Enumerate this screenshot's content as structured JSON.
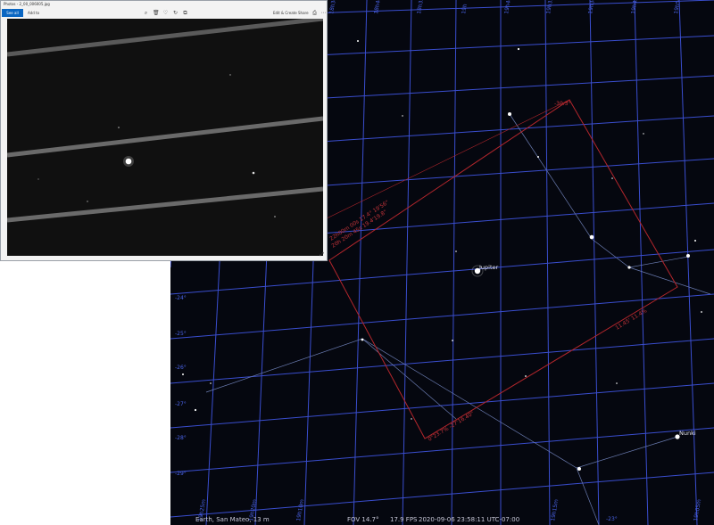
{
  "photos": {
    "title": "Photos - 2_00_006005.jpg",
    "see_all": "See all photos",
    "add_to": "Add to",
    "edit_create": "Edit & Create",
    "share": "Share",
    "icons": [
      "zoom-icon",
      "delete-icon",
      "favorite-icon",
      "rotate-icon",
      "crop-icon",
      "edit-icon",
      "share-icon",
      "print-icon",
      "more-icon",
      "expand-icon"
    ]
  },
  "sky": {
    "ra_labels": [
      "18h30m",
      "18h40m",
      "18h35m",
      "19h",
      "19h40m",
      "19h35m",
      "19h30m",
      "19h45m",
      "19h50m",
      "19h25m",
      "19h20m",
      "19h10m",
      "19h15m",
      "19h05m"
    ],
    "dec_labels": [
      "-23°",
      "-24°",
      "-25°",
      "-26°",
      "-27°",
      "-28°",
      "-29°"
    ],
    "jupiter": "Jupiter",
    "nunki": "Nunki",
    "box_labels": [
      "-30.3°",
      "22h00m 00s 17.4° 19'56\"",
      "20h 20m 45s 19.4'19.8\"",
      "11.45' 11.4%",
      "0\"23.7% -27'16.40\""
    ],
    "status_location": "Earth, San Mateo, 13 m",
    "status_fov": "FOV 14.7°",
    "status_fps": "17.9 FPS",
    "status_time": "2020-09-06 23:58:11 UTC-07:00"
  },
  "colors": {
    "grid": "#3a4ecf",
    "box": "#b3262c",
    "sky_bg": "#05070f",
    "accent": "#0a66c2"
  }
}
